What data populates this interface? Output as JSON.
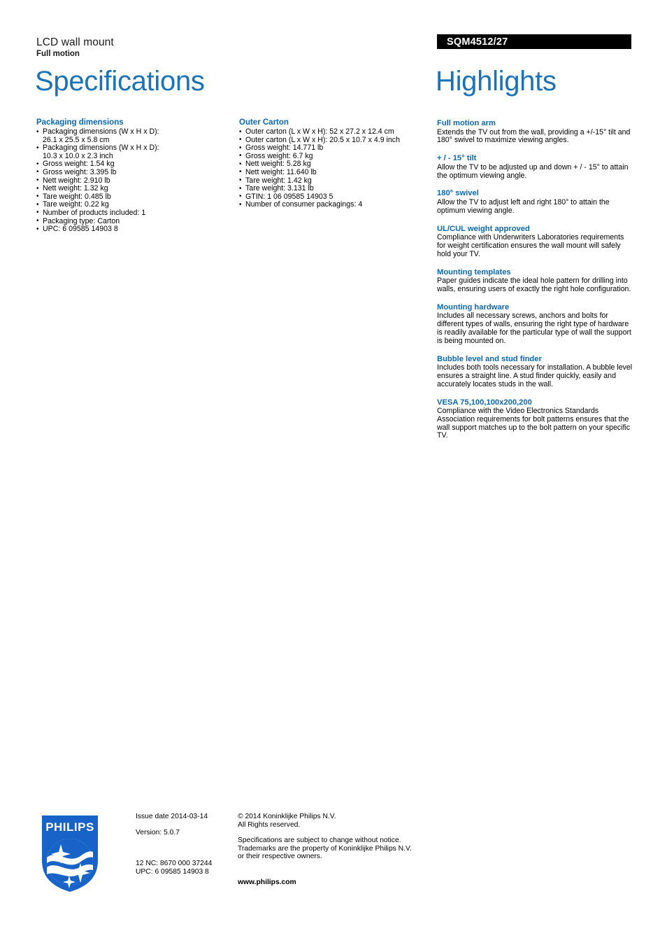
{
  "header": {
    "product_category": "LCD wall mount",
    "product_subtitle": "Full motion",
    "product_code": "SQM4512/27",
    "title_left": "Specifications",
    "title_right": "Highlights"
  },
  "colors": {
    "heading_blue": "#0a67b1",
    "title_blue": "#1b73b5",
    "code_bar_bg": "#000000",
    "logo_blue": "#1763c8"
  },
  "specifications": [
    {
      "group": "Packaging dimensions",
      "items": [
        {
          "text": "Packaging dimensions (W x H x D):",
          "cont": "26.1 x 25.5 x 5.8 cm"
        },
        {
          "text": "Packaging dimensions (W x H x D):",
          "cont": "10.3 x 10.0 x 2.3 inch"
        },
        {
          "text": "Gross weight: 1.54 kg"
        },
        {
          "text": "Gross weight: 3.395 lb"
        },
        {
          "text": "Nett weight: 2.910 lb"
        },
        {
          "text": "Nett weight: 1.32 kg"
        },
        {
          "text": "Tare weight: 0.485 lb"
        },
        {
          "text": "Tare weight: 0.22 kg"
        },
        {
          "text": "Number of products included: 1"
        },
        {
          "text": "Packaging type: Carton"
        },
        {
          "text": "UPC: 6 09585 14903 8"
        }
      ]
    },
    {
      "group": "Outer Carton",
      "items": [
        {
          "text": "Outer carton (L x W x H): 52 x 27.2 x 12.4 cm"
        },
        {
          "text": "Outer carton (L x W x H): 20.5 x 10.7 x 4.9 inch"
        },
        {
          "text": "Gross weight: 14.771 lb"
        },
        {
          "text": "Gross weight: 6.7 kg"
        },
        {
          "text": "Nett weight: 5.28 kg"
        },
        {
          "text": "Nett weight: 11.640 lb"
        },
        {
          "text": "Tare weight: 1.42 kg"
        },
        {
          "text": "Tare weight: 3.131 lb"
        },
        {
          "text": "GTIN: 1 06 09585 14903 5"
        },
        {
          "text": "Number of consumer packagings: 4"
        }
      ]
    }
  ],
  "highlights": [
    {
      "title": "Full motion arm",
      "body": "Extends the TV out from the wall, providing a +/-15° tilt and 180° swivel to maximize viewing angles."
    },
    {
      "title": "+ / - 15° tilt",
      "body": "Allow the TV to be adjusted up and down + / - 15° to attain the optimum viewing angle."
    },
    {
      "title": "180° swivel",
      "body": "Allow the TV to adjust left and right 180° to attain the optimum viewing angle."
    },
    {
      "title": "UL/CUL weight approved",
      "body": "Compliance with Underwriters Laboratories requirements for weight certification ensures the wall mount will safely hold your TV."
    },
    {
      "title": "Mounting templates",
      "body": "Paper guides indicate the ideal hole pattern for drilling into walls, ensuring users of exactly the right hole configuration."
    },
    {
      "title": "Mounting hardware",
      "body": "Includes all necessary screws, anchors and bolts for different types of walls, ensuring the right type of hardware is readily available for the particular type of wall the support is being mounted on."
    },
    {
      "title": "Bubble level and stud finder",
      "body": "Includes both tools necessary for installation. A bubble level ensures a straight line. A stud finder quickly, easily and accurately locates studs in the wall."
    },
    {
      "title": "VESA 75,100,100x200,200",
      "body": "Compliance with the Video Electronics Standards Association requirements for bolt patterns ensures that the wall support matches up to the bolt pattern on your specific TV."
    }
  ],
  "footer": {
    "logo_wordmark": "PHILIPS",
    "issue_date": "Issue date 2014-03-14",
    "version": "Version: 5.0.7",
    "nc_code": "12 NC: 8670 000 37244",
    "upc": "UPC: 6 09585 14903 8",
    "copyright_line1": "© 2014 Koninklijke Philips N.V.",
    "copyright_line2": "All Rights reserved.",
    "disclaimer_line1": "Specifications are subject to change without notice.",
    "disclaimer_line2": "Trademarks are the property of Koninklijke Philips N.V.",
    "disclaimer_line3": "or their respective owners.",
    "website": "www.philips.com"
  }
}
